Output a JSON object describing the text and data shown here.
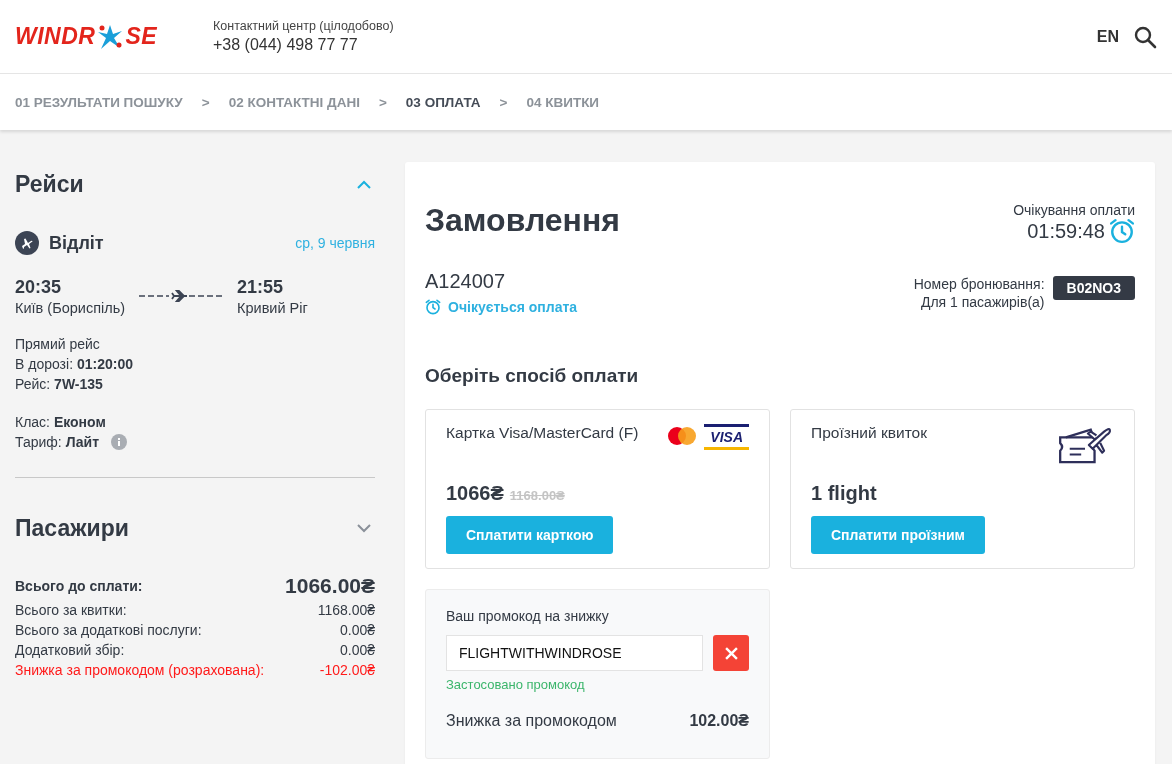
{
  "header": {
    "logo": {
      "left": "WINDR",
      "right": "SE"
    },
    "contact_label": "Контактний центр (цілодобово)",
    "phone": "+38 (044) 498 77 77",
    "language": "EN"
  },
  "steps": [
    {
      "label": "01 РЕЗУЛЬТАТИ ПОШУКУ",
      "selected": false
    },
    {
      "label": "02 КОНТАКТНІ ДАНІ",
      "selected": false
    },
    {
      "label": "03 ОПЛАТА",
      "selected": true
    },
    {
      "label": "04 КВИТКИ",
      "selected": false
    }
  ],
  "step_separator": ">",
  "flights": {
    "title": "Рейси",
    "expanded": true,
    "direction": "Відліт",
    "date": "ср, 9 червня",
    "departure": {
      "time": "20:35",
      "city": "Київ (Бориспіль)"
    },
    "arrival": {
      "time": "21:55",
      "city": "Кривий Ріг"
    },
    "details": [
      "Прямий рейс",
      "В дорозі: **01:20:00**",
      "Рейс: **7W-135**"
    ],
    "fare": [
      "Клас: **Економ**",
      "Тариф: **Лайт**"
    ]
  },
  "passengers": {
    "title": "Пасажири",
    "expanded": false
  },
  "summary": [
    {
      "kind": "total",
      "label": "Всього до сплати:",
      "value": "1066.00₴"
    },
    {
      "kind": "line",
      "label": "Всього за квитки:",
      "value": "1168.00₴"
    },
    {
      "kind": "line",
      "label": "Всього за додаткові послуги:",
      "value": "0.00₴"
    },
    {
      "kind": "line",
      "label": "Додатковий збір:",
      "value": "0.00₴"
    },
    {
      "kind": "discount",
      "label": "Знижка за промокодом (розрахована):",
      "value": "-102.00₴"
    }
  ],
  "order": {
    "title": "Замовлення",
    "timer_label": "Очікування оплати",
    "timer": "01:59:48",
    "number": "A124007",
    "status": "Очікується оплата",
    "booking_label": "Номер бронювання:",
    "passengers_label": "Для 1 пасажирів(а)",
    "booking_code": "B02NO3"
  },
  "payment": {
    "title": "Оберіть спосіб оплати",
    "methods": [
      {
        "kind": "card",
        "name": "Картка Visa/MasterCard (F)",
        "price": "1066₴",
        "old_price": "1168.00₴",
        "visa_label": "VISA",
        "button": "Сплатити карткою"
      },
      {
        "kind": "pass",
        "name": "Проїзний квиток",
        "price": "1 flight",
        "button": "Сплатити проїзним"
      }
    ]
  },
  "promo": {
    "label": "Ваш промокод на знижку",
    "value": "FLIGHTWITHWINDROSE",
    "applied": "Застосовано промокод",
    "discount_label": "Знижка за промокодом",
    "discount_value": "102.00₴"
  }
}
